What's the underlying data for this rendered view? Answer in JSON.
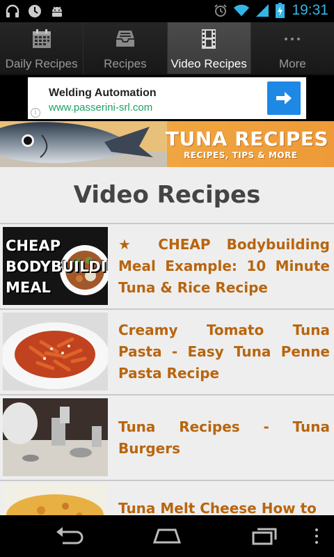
{
  "status_bar": {
    "time": "19:31",
    "left_icons": [
      "headphones-icon",
      "clock-icon",
      "android-icon"
    ],
    "right_icons": [
      "alarm-icon",
      "wifi-icon",
      "signal-icon",
      "battery-icon"
    ]
  },
  "tabs": [
    {
      "label": "Daily Recipes",
      "icon": "calendar-icon",
      "active": false
    },
    {
      "label": "Recipes",
      "icon": "inbox-icon",
      "active": false
    },
    {
      "label": "Video Recipes",
      "icon": "film-icon",
      "active": true
    },
    {
      "label": "More",
      "icon": "more-icon",
      "active": false
    }
  ],
  "ad": {
    "title": "Welding Automation",
    "url": "www.passerini-srl.com",
    "info": "i"
  },
  "banner": {
    "title": "TUNA RECIPES",
    "subtitle": "RECIPES, TIPS & MORE"
  },
  "page_title": "Video Recipes",
  "videos": [
    {
      "title": "★ CHEAP Bodybuilding Meal Example: 10 Minute Tuna & Rice Recipe",
      "thumb_text": "CHEAP BODYBUILDING MEAL"
    },
    {
      "title": "Creamy Tomato Tuna Pasta - Easy Tuna Penne Pasta Recipe"
    },
    {
      "title": "Tuna Recipes - Tuna Burgers"
    },
    {
      "title": "Tuna Melt Cheese How to"
    }
  ],
  "colors": {
    "accent_blue": "#33b5e5",
    "link_orange": "#b8650e",
    "banner_orange": "#f0a843"
  }
}
